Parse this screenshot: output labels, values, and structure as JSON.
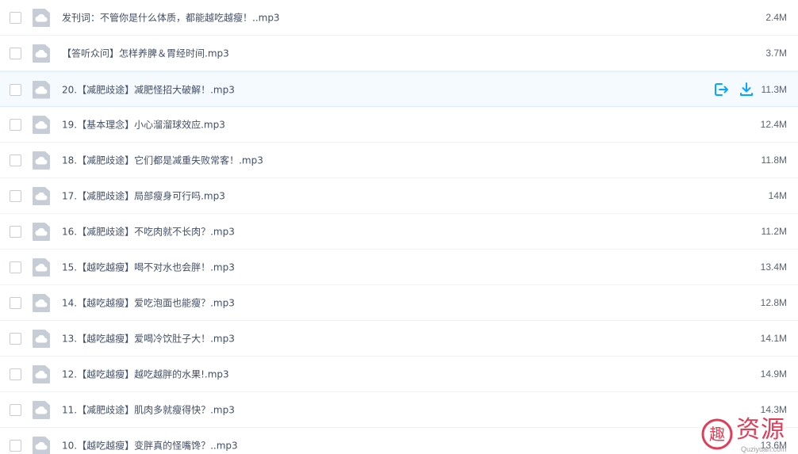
{
  "files": [
    {
      "name": "发刊词：不管你是什么体质，都能越吃越瘦！..mp3",
      "size": "2.4M",
      "icon": "audio-file-icon"
    },
    {
      "name": "【答听众问】怎样养脾＆胃经时间.mp3",
      "size": "3.7M",
      "icon": "audio-file-icon"
    },
    {
      "name": "20.【减肥歧途】减肥怪招大破解！.mp3",
      "size": "11.3M",
      "icon": "audio-file-icon"
    },
    {
      "name": "19.【基本理念】小心溜溜球效应.mp3",
      "size": "12.4M",
      "icon": "audio-file-icon"
    },
    {
      "name": "18.【减肥歧途】它们都是减重失败常客！.mp3",
      "size": "11.8M",
      "icon": "audio-file-icon"
    },
    {
      "name": "17.【减肥歧途】局部瘦身可行吗.mp3",
      "size": "14M",
      "icon": "audio-file-icon"
    },
    {
      "name": "16.【减肥歧途】不吃肉就不长肉？.mp3",
      "size": "11.2M",
      "icon": "audio-file-icon"
    },
    {
      "name": "15.【越吃越瘦】喝不对水也会胖！.mp3",
      "size": "13.4M",
      "icon": "audio-file-icon"
    },
    {
      "name": "14.【越吃越瘦】爱吃泡面也能瘦？.mp3",
      "size": "12.8M",
      "icon": "audio-file-icon"
    },
    {
      "name": "13.【越吃越瘦】爱喝冷饮肚子大！.mp3",
      "size": "14.1M",
      "icon": "audio-file-icon"
    },
    {
      "name": "12.【越吃越瘦】越吃越胖的水果!.mp3",
      "size": "14.9M",
      "icon": "audio-file-icon"
    },
    {
      "name": "11.【减肥歧途】肌肉多就瘦得快？.mp3",
      "size": "14.3M",
      "icon": "audio-file-icon"
    },
    {
      "name": "10.【越吃越瘦】变胖真的怪嘴馋？..mp3",
      "size": "13.6M",
      "icon": "audio-file-icon"
    }
  ],
  "hover_row_actions": {
    "share_icon": "share-out-icon",
    "download_icon": "download-icon"
  },
  "watermark": {
    "logo_char": "趣",
    "text": "资源",
    "sub": "Quziyuan.com"
  },
  "colors": {
    "accent": "#06a7ff",
    "hover_bg": "#f4fafe",
    "watermark": "#e23d58",
    "file_icon": "#c7cdd6"
  }
}
